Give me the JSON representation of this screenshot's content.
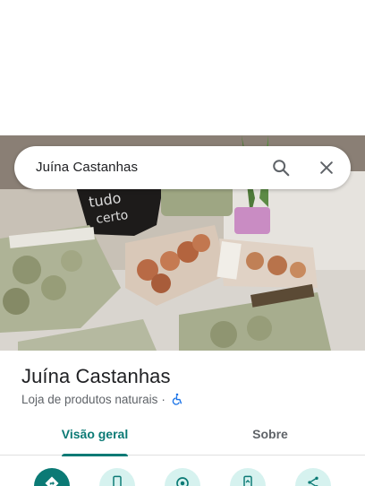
{
  "search": {
    "query": "Juína Castanhas"
  },
  "place": {
    "name": "Juína Castanhas",
    "category": "Loja de produtos naturais",
    "separator": "·"
  },
  "tabs": [
    {
      "label": "Visão geral",
      "active": true
    },
    {
      "label": "Sobre",
      "active": false
    }
  ],
  "actions": [
    {
      "icon": "directions-icon"
    },
    {
      "icon": "phone-icon"
    },
    {
      "icon": "save-icon"
    },
    {
      "icon": "send-to-phone-icon"
    },
    {
      "icon": "share-icon"
    }
  ],
  "colors": {
    "accent": "#0b7a75",
    "action_bg": "#d6f2ef",
    "accessibility_icon": "#1a73e8"
  }
}
